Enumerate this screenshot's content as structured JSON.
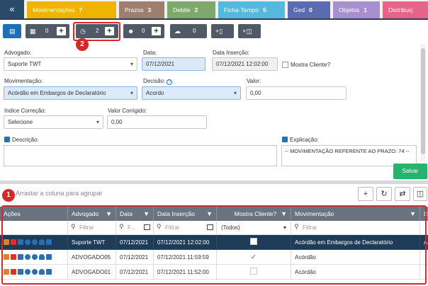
{
  "tabs": {
    "back_icon": "«",
    "items": [
      {
        "label": "Movimentações",
        "count": "7",
        "color": "#f0b400"
      },
      {
        "label": "Prazos",
        "count": "3",
        "color": "#9e7e6e"
      },
      {
        "label": "Debite",
        "count": "2",
        "color": "#7fa86b"
      },
      {
        "label": "Ficha-Tempo",
        "count": "5",
        "color": "#55b8de"
      },
      {
        "label": "Ged",
        "count": "0",
        "color": "#5b6bb0"
      },
      {
        "label": "Objetos",
        "count": "1",
        "color": "#a88fd0"
      },
      {
        "label": "Distribuiç",
        "count": "",
        "color": "#e6648a"
      }
    ]
  },
  "toolbar": {
    "btn_calendar_count": "0",
    "btn_clock_count": "2",
    "btn_user_count": "0",
    "btn_cloud_count": "0",
    "plus": "+"
  },
  "callouts": {
    "first": "1",
    "second": "2"
  },
  "form": {
    "advogado_label": "Advogado:",
    "advogado_value": "Suporte TWT",
    "data_label": "Data:",
    "data_value": "07/12/2021",
    "data_insercao_label": "Data Inserção:",
    "data_insercao_value": "07/12/2021 12:02:00",
    "mostra_cliente_label": "Mostra Cliente?",
    "movimentacao_label": "Movimentação:",
    "movimentacao_value": "Acórdão em Embargos de Declaratório",
    "decisao_label": "Decisão:",
    "decisao_value": "Acordo",
    "valor_label": "Valor:",
    "valor_value": "0,00",
    "indice_label": "Indice Correção:",
    "indice_value": "Selecione",
    "valor_corrigido_label": "Valor Corrigido:",
    "valor_corrigido_value": "0,00",
    "descricao_label": "Descrição:",
    "explicacao_label": "Explicação:",
    "explicacao_value": "-- MOVIMENTAÇÃO REFERENTE AO PRAZO: 74 --",
    "save_label": "Salvar"
  },
  "grid": {
    "group_hint": "Arrastar a coluna para agrupar",
    "columns": [
      "Ações",
      "Advogado",
      "Data",
      "Data Inserção",
      "Mostra Cliente?",
      "Movimentação",
      "D"
    ],
    "filter_placeholder": "Filtrar",
    "filter_short": "F...",
    "filter_todos": "(Todos)",
    "rows": [
      {
        "advogado": "Suporte TWT",
        "data": "07/12/2021",
        "insercao": "07/12/2021 12:02:00",
        "mostra": "box",
        "mov": "Acórdão em Embargos de Declaratório",
        "d": "A"
      },
      {
        "advogado": "ADVOGADO05",
        "data": "07/12/2021",
        "insercao": "07/12/2021 11:59:59",
        "mostra": "check",
        "mov": "Acórdão",
        "d": ""
      },
      {
        "advogado": "ADVOGADO01",
        "data": "07/12/2021",
        "insercao": "07/12/2021 11:52:00",
        "mostra": "",
        "mov": "Acórdão",
        "d": ""
      }
    ]
  }
}
